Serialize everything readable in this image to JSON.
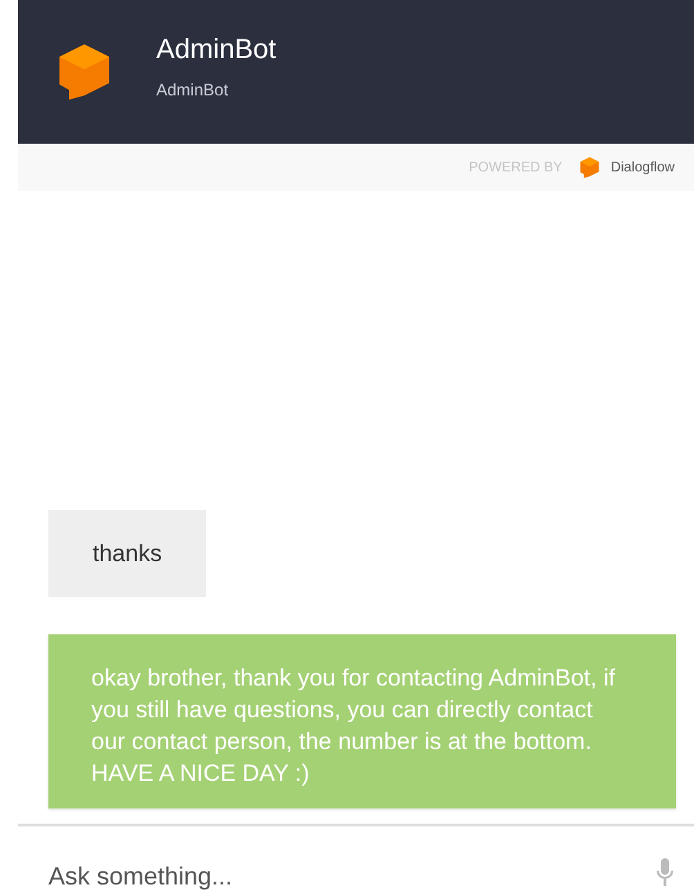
{
  "header": {
    "title": "AdminBot",
    "subtitle": "AdminBot"
  },
  "powered_by": {
    "label": "POWERED BY",
    "brand": "Dialogflow"
  },
  "messages": [
    {
      "kind": "user",
      "text": "thanks"
    },
    {
      "kind": "bot",
      "text": "okay brother, thank you for contacting AdminBot, if you still have questions, you can directly contact our contact person, the number is at the bottom. HAVE A NICE DAY :)"
    }
  ],
  "input": {
    "placeholder": "Ask something..."
  }
}
